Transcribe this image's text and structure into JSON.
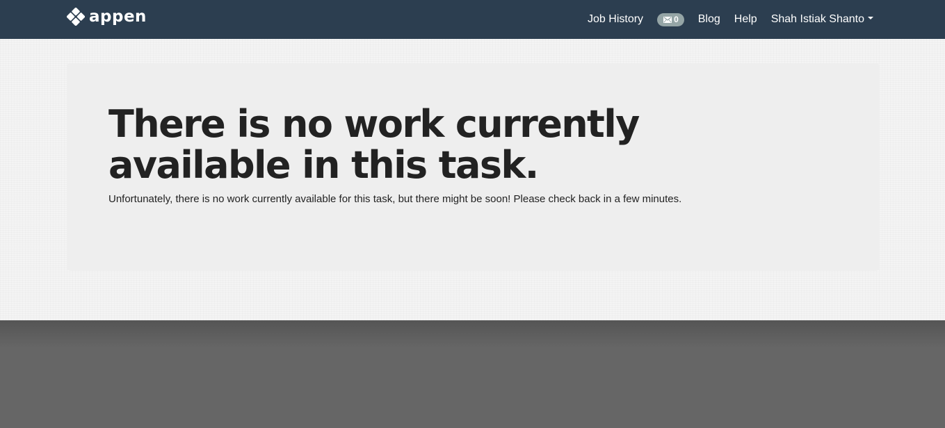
{
  "brand": {
    "name": "appen",
    "logo_icon": "diamond-cluster-icon"
  },
  "nav": {
    "job_history": "Job History",
    "messages": {
      "icon": "envelope-icon",
      "count": "0",
      "badge_color": "#95a5a6"
    },
    "blog": "Blog",
    "help": "Help",
    "user": "Shah Istiak Shanto",
    "user_menu_icon": "caret-down-icon"
  },
  "main": {
    "heading": "There is no work currently available in this task.",
    "message": "Unfortunately, there is no work currently available for this task, but there might be soon! Please check back in a few minutes."
  },
  "colors": {
    "navbar": "#2c3e50",
    "panel": "#eeeeee",
    "text": "#222222",
    "footer_area": "#666666"
  }
}
